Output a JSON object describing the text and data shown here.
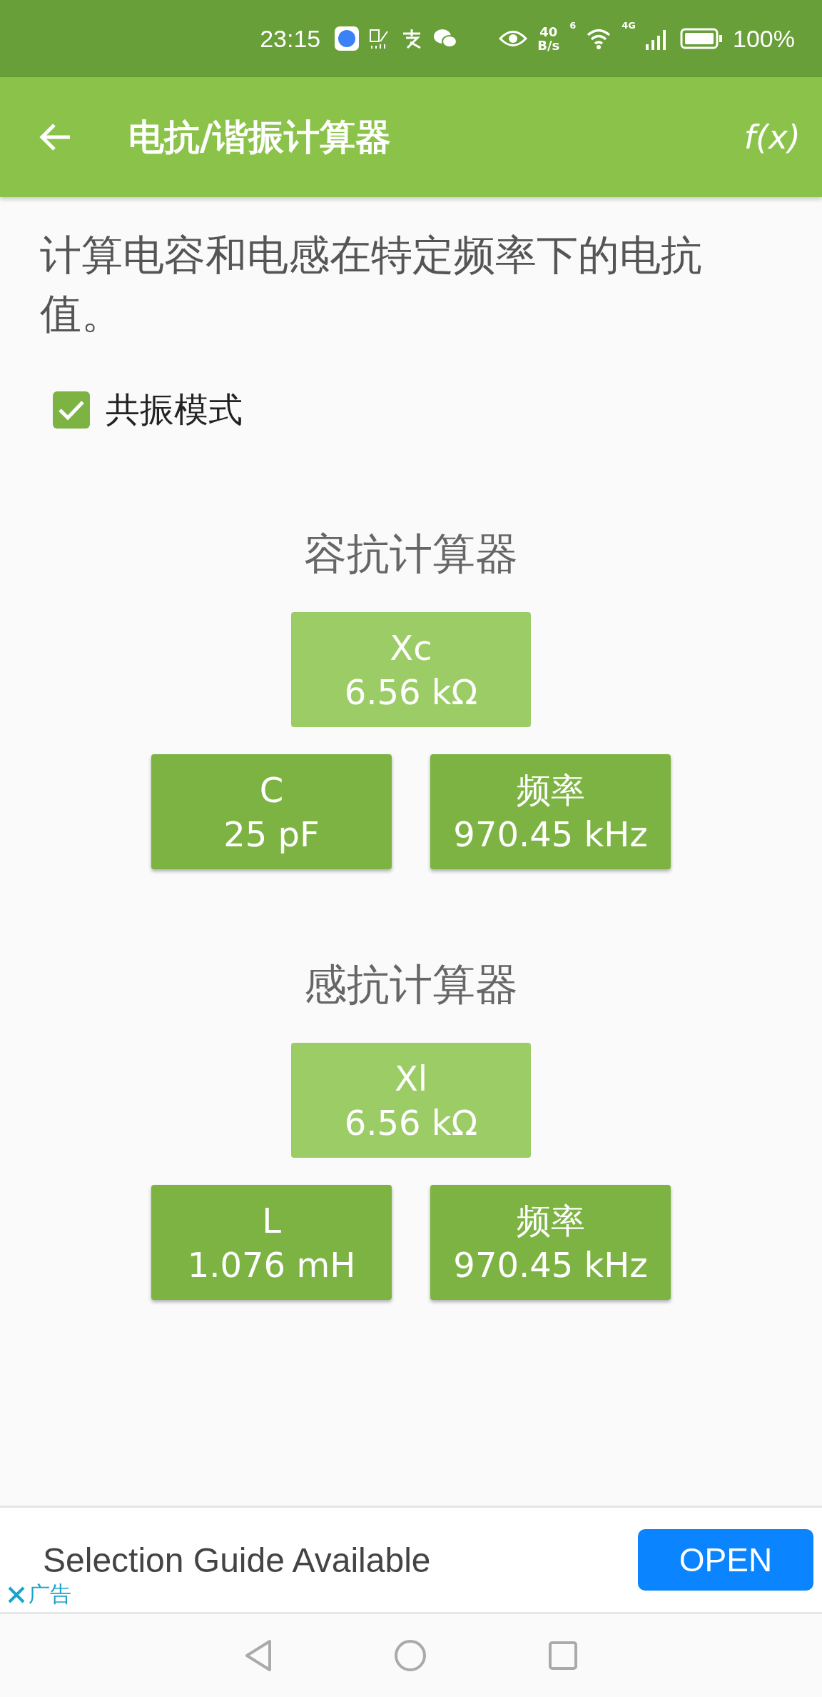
{
  "status_bar": {
    "time": "23:15",
    "speed_value": "40",
    "speed_unit": "B/s",
    "wifi_label": "6",
    "signal_label": "4G",
    "battery": "100%"
  },
  "toolbar": {
    "title": "电抗/谐振计算器",
    "action": "f(x)"
  },
  "description": "计算电容和电感在特定频率下的电抗值。",
  "resonance_mode": {
    "label": "共振模式",
    "checked": true
  },
  "sections": [
    {
      "title": "容抗计算器",
      "result": {
        "label": "Xc",
        "value": "6.56 kΩ"
      },
      "inputs": [
        {
          "label": "C",
          "value": "25 pF"
        },
        {
          "label": "频率",
          "value": "970.45 kHz"
        }
      ]
    },
    {
      "title": "感抗计算器",
      "result": {
        "label": "Xl",
        "value": "6.56 kΩ"
      },
      "inputs": [
        {
          "label": "L",
          "value": "1.076 mH"
        },
        {
          "label": "频率",
          "value": "970.45 kHz"
        }
      ]
    }
  ],
  "ad": {
    "text": "Selection Guide Available",
    "button": "OPEN",
    "label": "广告"
  }
}
